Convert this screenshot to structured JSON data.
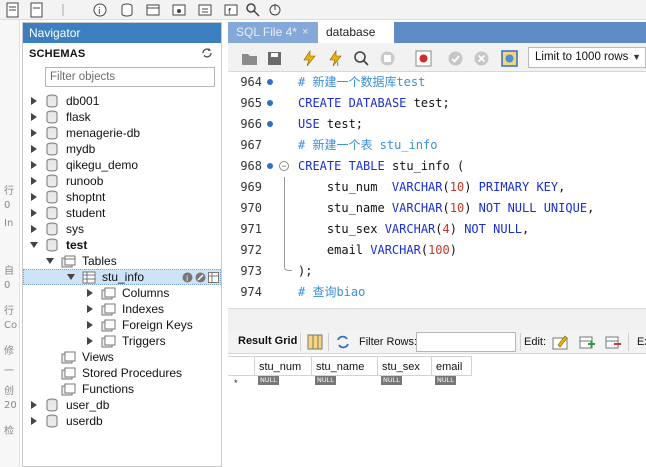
{
  "navigator": {
    "title": "Navigator",
    "schemas_label": "SCHEMAS",
    "filter_placeholder": "Filter objects"
  },
  "tree": {
    "databases_top": [
      "db001",
      "flask",
      "menagerie-db",
      "mydb",
      "qikegu_demo",
      "runoob",
      "shoptnt",
      "student",
      "sys"
    ],
    "open_db": "test",
    "tables_folder": "Tables",
    "selected_table": "stu_info",
    "table_children": [
      "Columns",
      "Indexes",
      "Foreign Keys",
      "Triggers"
    ],
    "other_folders": [
      "Views",
      "Stored Procedures",
      "Functions"
    ],
    "databases_bottom": [
      "user_db",
      "userdb"
    ]
  },
  "editor": {
    "tabs": [
      "SQL File 4*",
      "database"
    ],
    "tab_close": "×",
    "limit_label": "Limit to 1000 rows",
    "lines": [
      {
        "no": "964",
        "marker": true,
        "fold": false,
        "type": "comment",
        "text": "# 新建一个数据库test"
      },
      {
        "no": "965",
        "marker": true,
        "fold": false,
        "type": "sql",
        "text": "CREATE DATABASE test;"
      },
      {
        "no": "966",
        "marker": true,
        "fold": false,
        "type": "sql",
        "text": "USE test;"
      },
      {
        "no": "967",
        "marker": false,
        "fold": false,
        "type": "comment",
        "text": "# 新建一个表 stu_info"
      },
      {
        "no": "968",
        "marker": true,
        "fold": true,
        "type": "sql",
        "text": "CREATE TABLE stu_info ("
      },
      {
        "no": "969",
        "marker": false,
        "fold": false,
        "type": "sql",
        "text": "    stu_num  VARCHAR(10) PRIMARY KEY,"
      },
      {
        "no": "970",
        "marker": false,
        "fold": false,
        "type": "sql",
        "text": "    stu_name VARCHAR(10) NOT NULL UNIQUE,"
      },
      {
        "no": "971",
        "marker": false,
        "fold": false,
        "type": "sql",
        "text": "    stu_sex VARCHAR(4) NOT NULL,"
      },
      {
        "no": "972",
        "marker": false,
        "fold": false,
        "type": "sql",
        "text": "    email VARCHAR(100)"
      },
      {
        "no": "973",
        "marker": false,
        "fold": false,
        "type": "sql",
        "text": ");"
      },
      {
        "no": "974",
        "marker": false,
        "fold": false,
        "type": "comment",
        "text": "# 查询biao"
      }
    ]
  },
  "result": {
    "grid_label": "Result Grid",
    "filter_rows_label": "Filter Rows:",
    "edit_label": "Edit:",
    "export_label": "Ex",
    "columns": [
      "stu_num",
      "stu_name",
      "stu_sex",
      "email"
    ],
    "null_label": "NULL",
    "row_marker": "*"
  },
  "left_strip": [
    "行",
    "0",
    "In",
    "自",
    "0",
    "行",
    "Co",
    "修",
    "一",
    "创",
    "20",
    "检"
  ],
  "colors": {
    "navigator_header": "#3c7fc0",
    "tab_bar": "#5f8bc5",
    "keyword": "#1a2fd0",
    "number": "#c0392b",
    "comment": "#3c8fd8",
    "selection": "#cde3f7"
  }
}
